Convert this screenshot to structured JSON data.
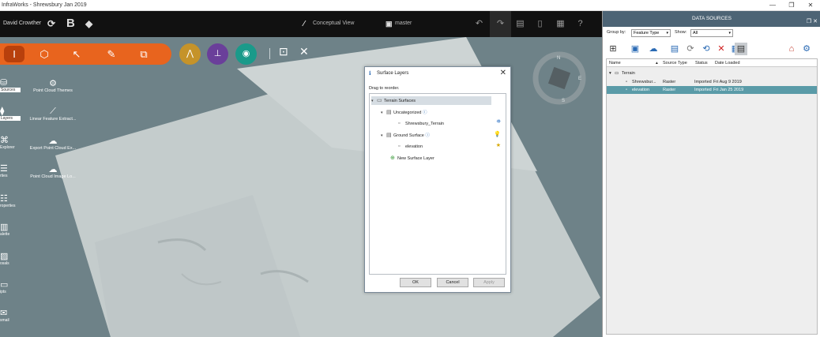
{
  "window": {
    "title": "InfraWorks - Shrewsbury Jan 2019",
    "controls": [
      "—",
      "❐",
      "✕"
    ]
  },
  "header": {
    "user": "David Crowther",
    "view_mode": "Conceptual View",
    "branch": "master"
  },
  "left_strip": [
    {
      "label": "Sources",
      "icon": "database-icon",
      "active": true
    },
    {
      "label": "Layers",
      "icon": "layers-icon",
      "active": true
    },
    {
      "label": "Explorer",
      "icon": "explorer-icon",
      "active": false
    },
    {
      "label": "rties",
      "icon": "properties-icon",
      "active": false
    },
    {
      "label": "roperties",
      "icon": "properties-icon",
      "active": false
    },
    {
      "label": "alette",
      "icon": "palette-icon",
      "active": false
    },
    {
      "label": "osals",
      "icon": "proposals-icon",
      "active": false
    },
    {
      "label": "ipts",
      "icon": "scripts-icon",
      "active": false
    },
    {
      "label": "smail",
      "icon": "email-icon",
      "active": false
    }
  ],
  "point_cloud_items": [
    {
      "label": "Point Cloud Themes",
      "icon": "point-cloud-themes-icon"
    },
    {
      "label": "Linear Feature Extract...",
      "icon": "linear-feature-icon"
    },
    {
      "label": "Export Point Cloud Ex...",
      "icon": "export-cloud-icon"
    },
    {
      "label": "Point Cloud Image Lo...",
      "icon": "image-locate-icon"
    }
  ],
  "compass_letters": [
    "N",
    "E",
    "S"
  ],
  "dialog": {
    "title": "Surface Layers",
    "hint": "Drag to reorder.",
    "tree": [
      {
        "label": "Terrain Surfaces",
        "level": 0,
        "selected": true
      },
      {
        "label": "Uncategorized",
        "level": 1,
        "selected": false
      },
      {
        "label": "Shrewsbury_Terrain",
        "level": 2,
        "selected": false
      },
      {
        "label": "Ground Surface",
        "level": 1,
        "selected": false
      },
      {
        "label": "elevation",
        "level": 2,
        "selected": false
      },
      {
        "label": "New Surface Layer",
        "level": 1,
        "selected": false
      }
    ],
    "buttons": {
      "ok": "OK",
      "cancel": "Cancel",
      "apply": "Apply"
    }
  },
  "panel": {
    "title": "DATA SOURCES",
    "group_by_label": "Group by:",
    "group_by_value": "Feature Type",
    "show_label": "Show:",
    "show_value": "All",
    "columns": {
      "name": "Name",
      "source_type": "Source Type",
      "status": "Status",
      "date_loaded": "Date Loaded"
    },
    "group": "Terrain",
    "rows": [
      {
        "name": "Shrewsbur...",
        "source_type": "Raster",
        "status": "Imported",
        "date": "Fri Aug 9 2019",
        "selected": false
      },
      {
        "name": "elevation",
        "source_type": "Raster",
        "status": "Imported",
        "date": "Fri Jan 25 2019",
        "selected": true
      }
    ]
  },
  "colors": {
    "accent": "#e8641e",
    "panel_header": "#4d6475",
    "selection": "#5a9ba8"
  }
}
